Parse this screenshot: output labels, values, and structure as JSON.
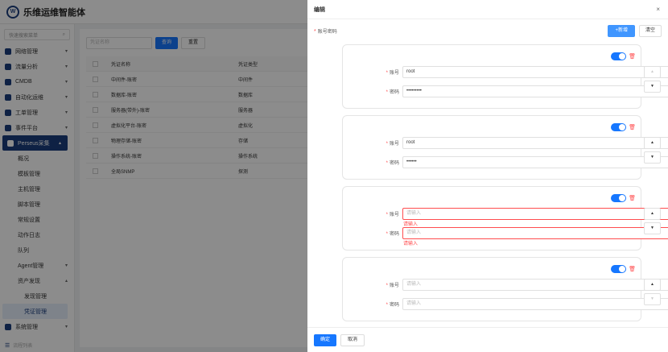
{
  "app": {
    "brand": "乐维运维智能体",
    "logo_letter": "W"
  },
  "sidebar": {
    "search_placeholder": "快速搜索菜单",
    "menu": [
      {
        "label": "网络管理",
        "icon": "network-icon"
      },
      {
        "label": "流量分析",
        "icon": "chart-icon"
      },
      {
        "label": "CMDB",
        "icon": "database-icon"
      },
      {
        "label": "自动化运维",
        "icon": "automation-icon"
      },
      {
        "label": "工单管理",
        "icon": "ticket-icon"
      },
      {
        "label": "事件平台",
        "icon": "bell-icon"
      },
      {
        "label": "Perseus采集",
        "icon": "collect-icon"
      }
    ],
    "sub": [
      "概况",
      "模板管理",
      "主机管理",
      "脚本管理",
      "常规设置",
      "动作日志",
      "队列",
      "Agent管理",
      "资产发现"
    ],
    "subsub": [
      "发现管理",
      "凭证管理"
    ],
    "system": "系统管理",
    "bottom": "流程列表"
  },
  "background": {
    "filter_placeholder": "凭证名称",
    "query_label": "查询",
    "reset_label": "重置",
    "columns": [
      "凭证名称",
      "凭证类型"
    ],
    "rows": [
      [
        "中间件-账密",
        "中间件"
      ],
      [
        "数据库-账密",
        "数据库"
      ],
      [
        "服务器(带外)-账密",
        "服务器"
      ],
      [
        "虚拟化平台-账密",
        "虚拟化"
      ],
      [
        "物理存储-账密",
        "存储"
      ],
      [
        "操作系统-账密",
        "操作系统"
      ],
      [
        "全局SNMP",
        "探测"
      ]
    ]
  },
  "drawer": {
    "title": "编辑",
    "close": "×",
    "field_label": "账号密码",
    "add_label": "+新增",
    "clear_label": "清空",
    "account_label": "账号",
    "password_label": "密码",
    "placeholder": "请输入",
    "error_text": "请输入",
    "up_arrow": "▲",
    "down_arrow": "▼",
    "trash_icon": "🗑",
    "cards": [
      {
        "account": "root",
        "password": "•••••••••"
      },
      {
        "account": "root",
        "password": "••••••"
      },
      {
        "account": "",
        "password": ""
      },
      {
        "account": "",
        "password": ""
      }
    ],
    "ok_label": "确定",
    "cancel_label": "取消"
  },
  "colors": {
    "primary": "#1677ff",
    "navy": "#1a3d7c",
    "error": "#ff4d4f"
  }
}
